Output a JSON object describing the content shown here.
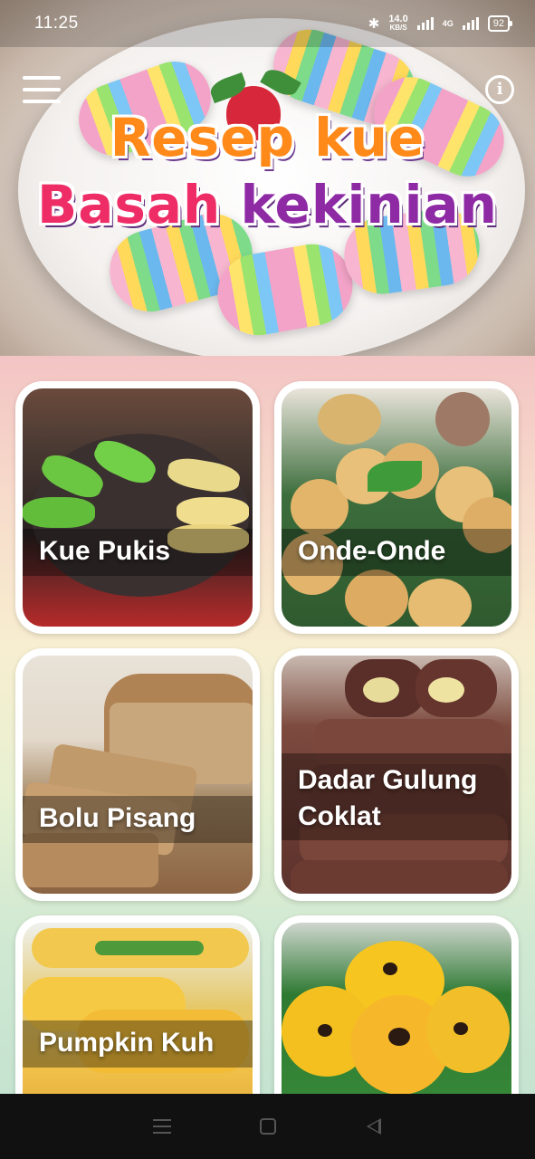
{
  "status_bar": {
    "time": "11:25",
    "net_speed_value": "14.0",
    "net_speed_unit": "KB/S",
    "network_type": "4G",
    "battery": "92"
  },
  "header": {
    "title_line1": "Resep kue",
    "title_line2_word1": "Basah",
    "title_line2_word2": "kekinian"
  },
  "cards": [
    {
      "label": "Kue Pukis"
    },
    {
      "label": "Onde-Onde"
    },
    {
      "label": "Bolu Pisang"
    },
    {
      "label": "Dadar Gulung Coklat"
    },
    {
      "label": "Pumpkin Kuh"
    },
    {
      "label": ""
    }
  ],
  "icons": {
    "menu": "hamburger-menu-icon",
    "info": "info-icon",
    "bluetooth": "bluetooth-icon",
    "signal": "signal-icon",
    "battery": "battery-icon",
    "nav_recent": "recent-apps-icon",
    "nav_home": "home-icon",
    "nav_back": "back-icon"
  },
  "colors": {
    "title_orange": "#ff8a1a",
    "title_pink": "#ee2d66",
    "title_purple": "#8e2aa4",
    "card_bg": "#ffffff"
  }
}
